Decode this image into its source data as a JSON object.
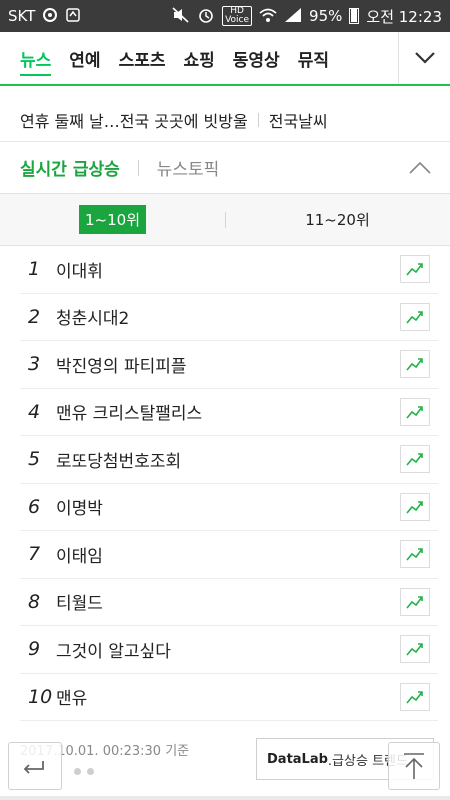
{
  "status_bar": {
    "carrier": "SKT",
    "network": "HD",
    "network_sub": "Voice",
    "battery": "95%",
    "time": "오전 12:23",
    "icons": [
      "circle-app-icon",
      "recycle-icon",
      "mute-icon",
      "alarm-icon",
      "hd-voice-icon",
      "wifi-icon",
      "signal-icon",
      "battery-icon"
    ]
  },
  "nav": {
    "tabs": [
      {
        "label": "뉴스",
        "active": true
      },
      {
        "label": "연예",
        "active": false
      },
      {
        "label": "스포츠",
        "active": false
      },
      {
        "label": "쇼핑",
        "active": false
      },
      {
        "label": "동영상",
        "active": false
      },
      {
        "label": "뮤직",
        "active": false
      }
    ],
    "more_icon": "chevron-down-icon",
    "accent": "#03c75a"
  },
  "headline": {
    "text": "연휴 둘째 날…전국 곳곳에 빗방울",
    "link": "전국날씨"
  },
  "section": {
    "title": "실시간 급상승",
    "other": "뉴스토픽",
    "toggle_icon": "chevron-up-icon"
  },
  "range": {
    "tabs": [
      {
        "label": "1~10위",
        "active": true
      },
      {
        "label": "11~20위",
        "active": false
      }
    ]
  },
  "ranking": [
    {
      "rank": "1",
      "keyword": "이대휘"
    },
    {
      "rank": "2",
      "keyword": "청춘시대2"
    },
    {
      "rank": "3",
      "keyword": "박진영의 파티피플"
    },
    {
      "rank": "4",
      "keyword": "맨유 크리스탈팰리스"
    },
    {
      "rank": "5",
      "keyword": "로또당첨번호조회"
    },
    {
      "rank": "6",
      "keyword": "이명박"
    },
    {
      "rank": "7",
      "keyword": "이태임"
    },
    {
      "rank": "8",
      "keyword": "티월드"
    },
    {
      "rank": "9",
      "keyword": "그것이 알고싶다"
    },
    {
      "rank": "10",
      "keyword": "맨유"
    }
  ],
  "footer": {
    "timestamp": "2017.10.01. 00:23:30 기준",
    "datalab_brand": "DataLab",
    "datalab_text": ".급상승 트렌드"
  },
  "colors": {
    "green": "#1aa53f",
    "trend_icon": "#23b24a"
  }
}
